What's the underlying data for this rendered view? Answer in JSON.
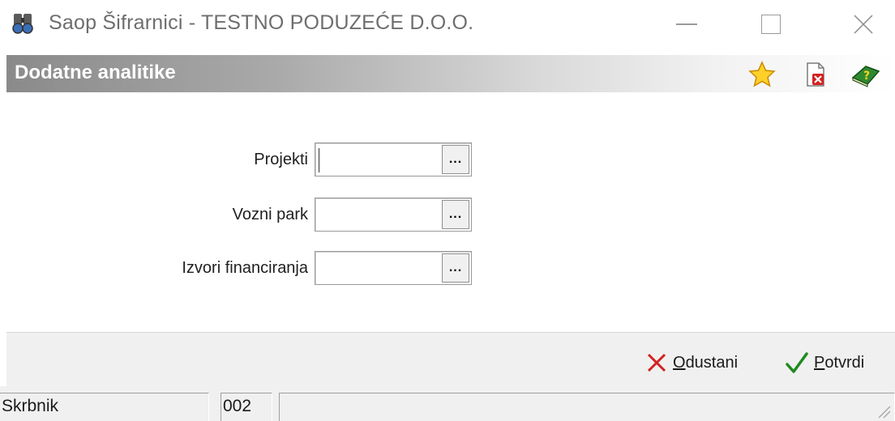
{
  "window": {
    "title": "Saop Šifrarnici - TESTNO PODUZEĆE D.O.O.",
    "app_icon": "binoculars-icon",
    "controls": [
      "minimize",
      "maximize",
      "close"
    ]
  },
  "panel": {
    "title": "Dodatne analitike",
    "header_icons": [
      "favorite-star-icon",
      "delete-document-icon",
      "help-book-icon"
    ]
  },
  "form": {
    "fields": [
      {
        "label": "Projekti",
        "value": "",
        "lookup_button": "..."
      },
      {
        "label": "Vozni park",
        "value": "",
        "lookup_button": "..."
      },
      {
        "label": "Izvori financiranja",
        "value": "",
        "lookup_button": "..."
      }
    ]
  },
  "actions": {
    "cancel": {
      "label_first": "O",
      "label_rest": "dustani"
    },
    "confirm": {
      "label_first": "P",
      "label_rest": "otvrdi"
    }
  },
  "status": {
    "user": "Skrbnik",
    "code": "002",
    "message": ""
  },
  "colors": {
    "header_gradient_start": "#8a8a8a",
    "cancel_icon": "#d42020",
    "confirm_icon": "#1e8a1e"
  }
}
